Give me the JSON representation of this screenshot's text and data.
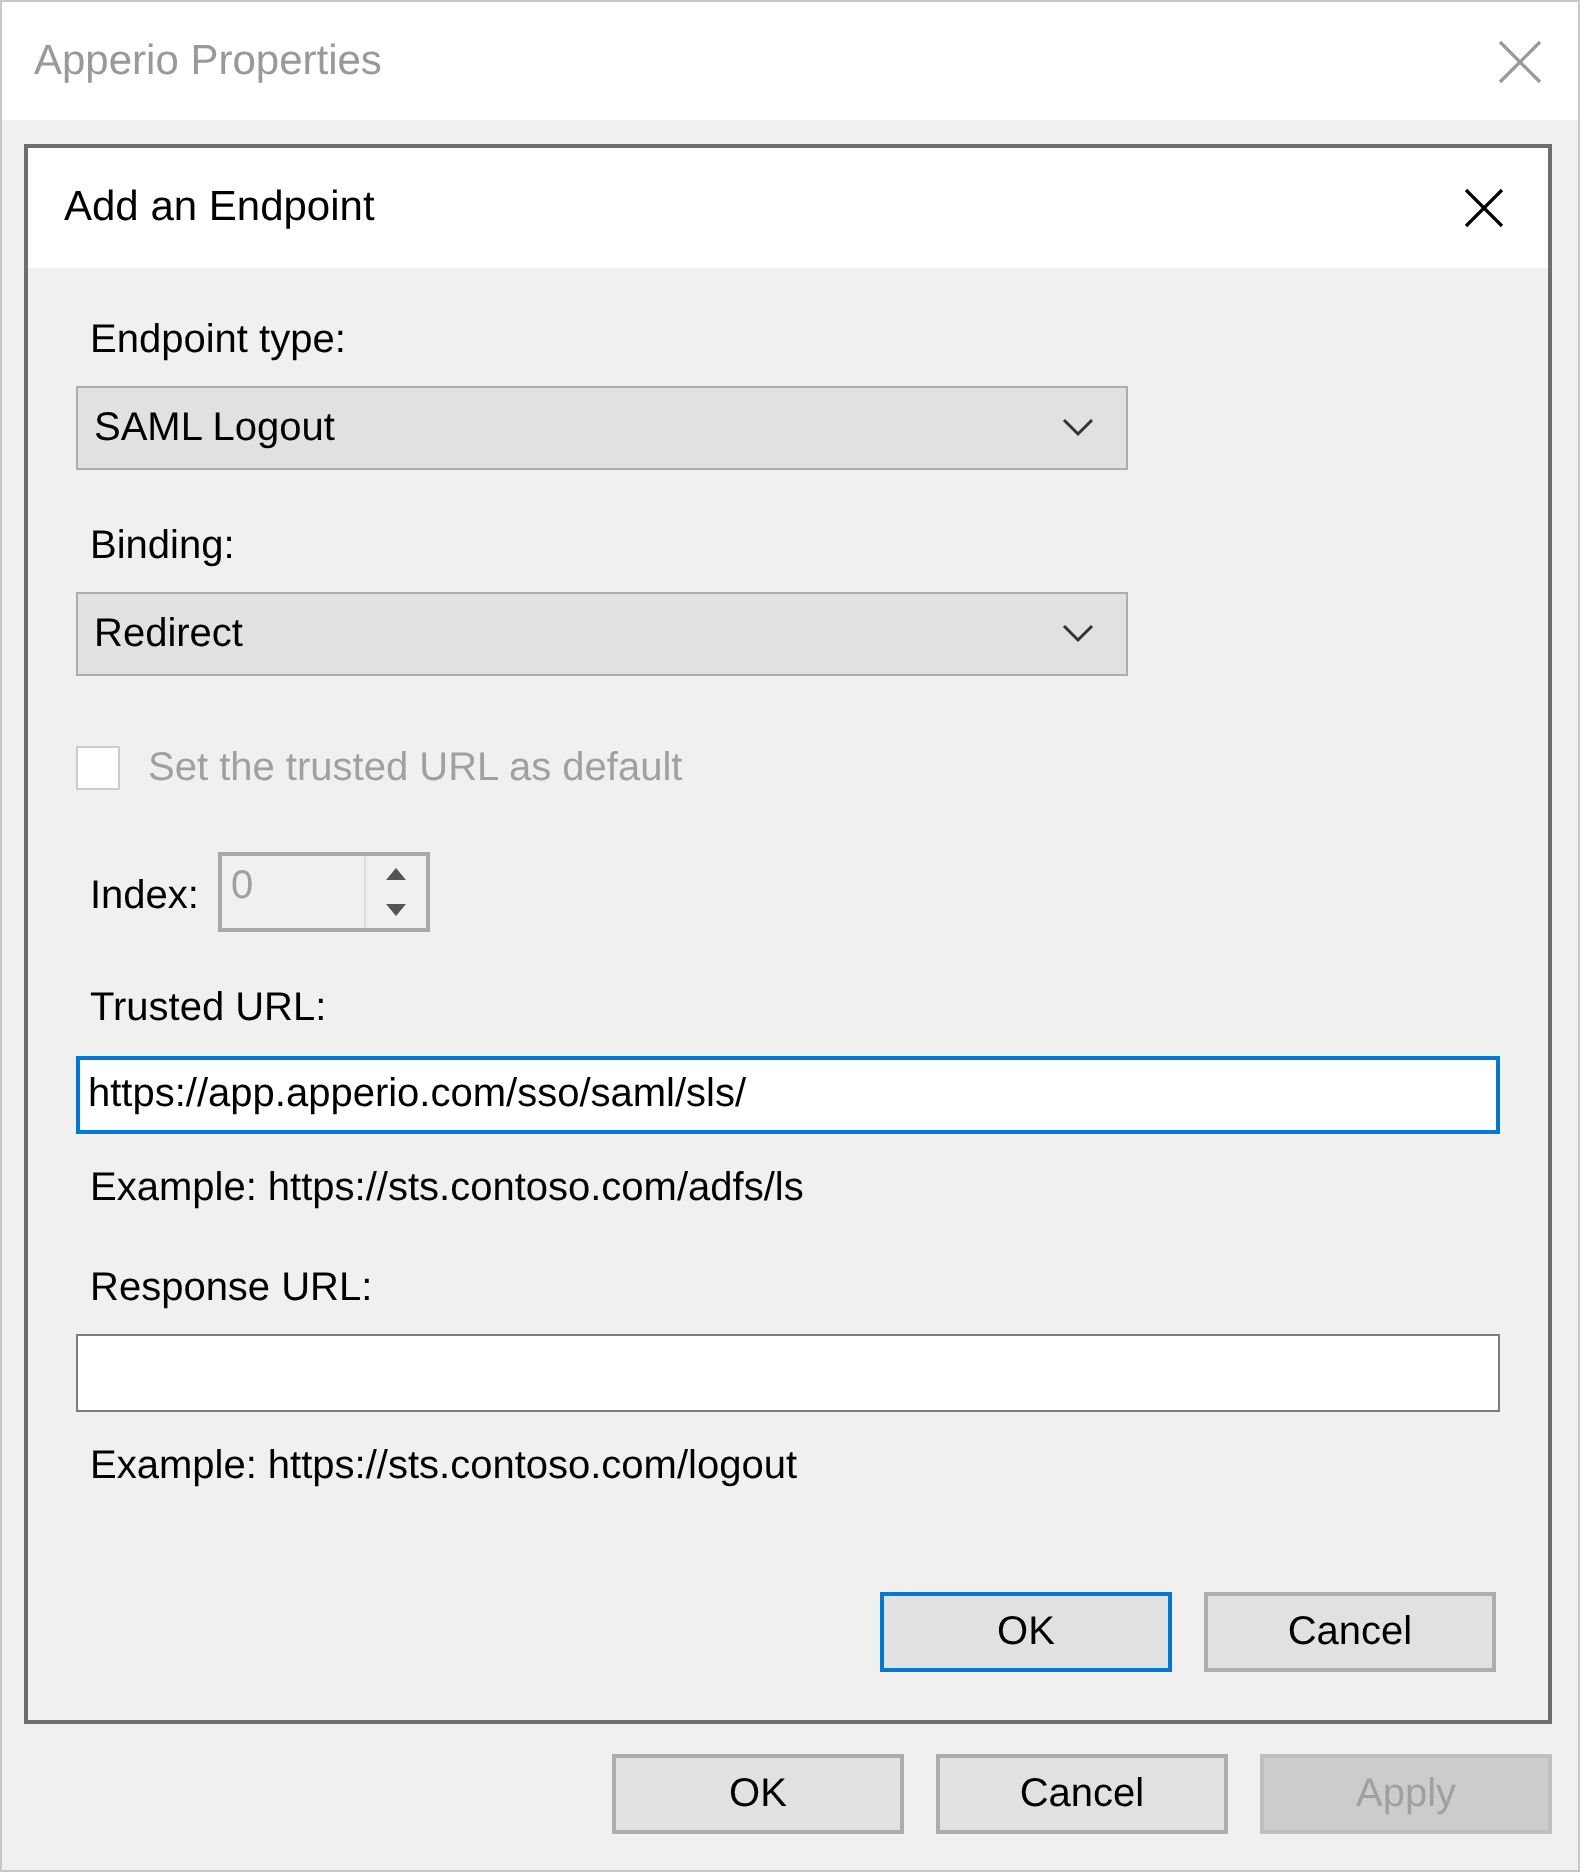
{
  "window": {
    "title": "Apperio Properties",
    "active": false
  },
  "dialog": {
    "title": "Add an Endpoint",
    "fields": [
      {
        "kind": "dropdown",
        "label": "Endpoint type:",
        "value": "SAML Logout"
      },
      {
        "kind": "dropdown",
        "label": "Binding:",
        "value": "Redirect"
      },
      {
        "kind": "checkbox",
        "label": "Set the trusted URL as default",
        "checked": false,
        "disabled": true
      },
      {
        "kind": "spinner",
        "label": "Index:",
        "value": "0",
        "disabled": true
      },
      {
        "kind": "text",
        "label": "Trusted URL:",
        "value": "https://app.apperio.com/sso/saml/sls/",
        "focused": true
      },
      {
        "kind": "note",
        "label": "Example: https://sts.contoso.com/adfs/ls"
      },
      {
        "kind": "text",
        "label": "Response URL:",
        "focused": false
      },
      {
        "kind": "note",
        "label": "Example: https://sts.contoso.com/logout"
      }
    ],
    "buttons": [
      {
        "label": "OK",
        "default": true
      },
      {
        "label": "Cancel",
        "default": false
      }
    ]
  },
  "buttons": [
    {
      "label": "OK",
      "disabled": false
    },
    {
      "label": "Cancel",
      "disabled": false
    },
    {
      "label": "Apply",
      "disabled": true
    }
  ]
}
